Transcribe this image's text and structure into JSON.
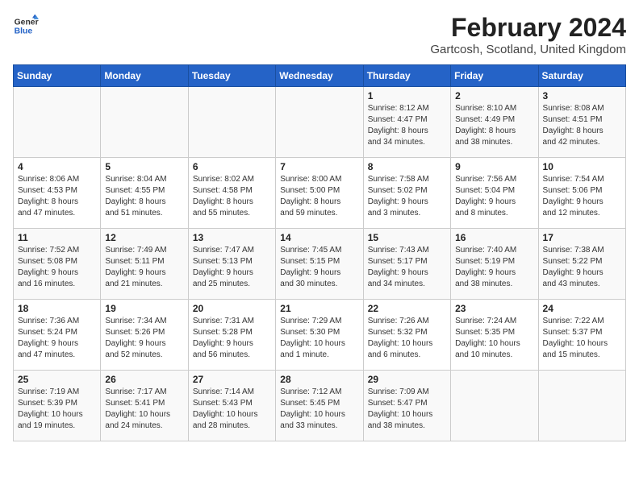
{
  "header": {
    "logo_general": "General",
    "logo_blue": "Blue",
    "month_title": "February 2024",
    "location": "Gartcosh, Scotland, United Kingdom"
  },
  "days_of_week": [
    "Sunday",
    "Monday",
    "Tuesday",
    "Wednesday",
    "Thursday",
    "Friday",
    "Saturday"
  ],
  "weeks": [
    [
      {
        "day": "",
        "content": ""
      },
      {
        "day": "",
        "content": ""
      },
      {
        "day": "",
        "content": ""
      },
      {
        "day": "",
        "content": ""
      },
      {
        "day": "1",
        "content": "Sunrise: 8:12 AM\nSunset: 4:47 PM\nDaylight: 8 hours\nand 34 minutes."
      },
      {
        "day": "2",
        "content": "Sunrise: 8:10 AM\nSunset: 4:49 PM\nDaylight: 8 hours\nand 38 minutes."
      },
      {
        "day": "3",
        "content": "Sunrise: 8:08 AM\nSunset: 4:51 PM\nDaylight: 8 hours\nand 42 minutes."
      }
    ],
    [
      {
        "day": "4",
        "content": "Sunrise: 8:06 AM\nSunset: 4:53 PM\nDaylight: 8 hours\nand 47 minutes."
      },
      {
        "day": "5",
        "content": "Sunrise: 8:04 AM\nSunset: 4:55 PM\nDaylight: 8 hours\nand 51 minutes."
      },
      {
        "day": "6",
        "content": "Sunrise: 8:02 AM\nSunset: 4:58 PM\nDaylight: 8 hours\nand 55 minutes."
      },
      {
        "day": "7",
        "content": "Sunrise: 8:00 AM\nSunset: 5:00 PM\nDaylight: 8 hours\nand 59 minutes."
      },
      {
        "day": "8",
        "content": "Sunrise: 7:58 AM\nSunset: 5:02 PM\nDaylight: 9 hours\nand 3 minutes."
      },
      {
        "day": "9",
        "content": "Sunrise: 7:56 AM\nSunset: 5:04 PM\nDaylight: 9 hours\nand 8 minutes."
      },
      {
        "day": "10",
        "content": "Sunrise: 7:54 AM\nSunset: 5:06 PM\nDaylight: 9 hours\nand 12 minutes."
      }
    ],
    [
      {
        "day": "11",
        "content": "Sunrise: 7:52 AM\nSunset: 5:08 PM\nDaylight: 9 hours\nand 16 minutes."
      },
      {
        "day": "12",
        "content": "Sunrise: 7:49 AM\nSunset: 5:11 PM\nDaylight: 9 hours\nand 21 minutes."
      },
      {
        "day": "13",
        "content": "Sunrise: 7:47 AM\nSunset: 5:13 PM\nDaylight: 9 hours\nand 25 minutes."
      },
      {
        "day": "14",
        "content": "Sunrise: 7:45 AM\nSunset: 5:15 PM\nDaylight: 9 hours\nand 30 minutes."
      },
      {
        "day": "15",
        "content": "Sunrise: 7:43 AM\nSunset: 5:17 PM\nDaylight: 9 hours\nand 34 minutes."
      },
      {
        "day": "16",
        "content": "Sunrise: 7:40 AM\nSunset: 5:19 PM\nDaylight: 9 hours\nand 38 minutes."
      },
      {
        "day": "17",
        "content": "Sunrise: 7:38 AM\nSunset: 5:22 PM\nDaylight: 9 hours\nand 43 minutes."
      }
    ],
    [
      {
        "day": "18",
        "content": "Sunrise: 7:36 AM\nSunset: 5:24 PM\nDaylight: 9 hours\nand 47 minutes."
      },
      {
        "day": "19",
        "content": "Sunrise: 7:34 AM\nSunset: 5:26 PM\nDaylight: 9 hours\nand 52 minutes."
      },
      {
        "day": "20",
        "content": "Sunrise: 7:31 AM\nSunset: 5:28 PM\nDaylight: 9 hours\nand 56 minutes."
      },
      {
        "day": "21",
        "content": "Sunrise: 7:29 AM\nSunset: 5:30 PM\nDaylight: 10 hours\nand 1 minute."
      },
      {
        "day": "22",
        "content": "Sunrise: 7:26 AM\nSunset: 5:32 PM\nDaylight: 10 hours\nand 6 minutes."
      },
      {
        "day": "23",
        "content": "Sunrise: 7:24 AM\nSunset: 5:35 PM\nDaylight: 10 hours\nand 10 minutes."
      },
      {
        "day": "24",
        "content": "Sunrise: 7:22 AM\nSunset: 5:37 PM\nDaylight: 10 hours\nand 15 minutes."
      }
    ],
    [
      {
        "day": "25",
        "content": "Sunrise: 7:19 AM\nSunset: 5:39 PM\nDaylight: 10 hours\nand 19 minutes."
      },
      {
        "day": "26",
        "content": "Sunrise: 7:17 AM\nSunset: 5:41 PM\nDaylight: 10 hours\nand 24 minutes."
      },
      {
        "day": "27",
        "content": "Sunrise: 7:14 AM\nSunset: 5:43 PM\nDaylight: 10 hours\nand 28 minutes."
      },
      {
        "day": "28",
        "content": "Sunrise: 7:12 AM\nSunset: 5:45 PM\nDaylight: 10 hours\nand 33 minutes."
      },
      {
        "day": "29",
        "content": "Sunrise: 7:09 AM\nSunset: 5:47 PM\nDaylight: 10 hours\nand 38 minutes."
      },
      {
        "day": "",
        "content": ""
      },
      {
        "day": "",
        "content": ""
      }
    ]
  ]
}
